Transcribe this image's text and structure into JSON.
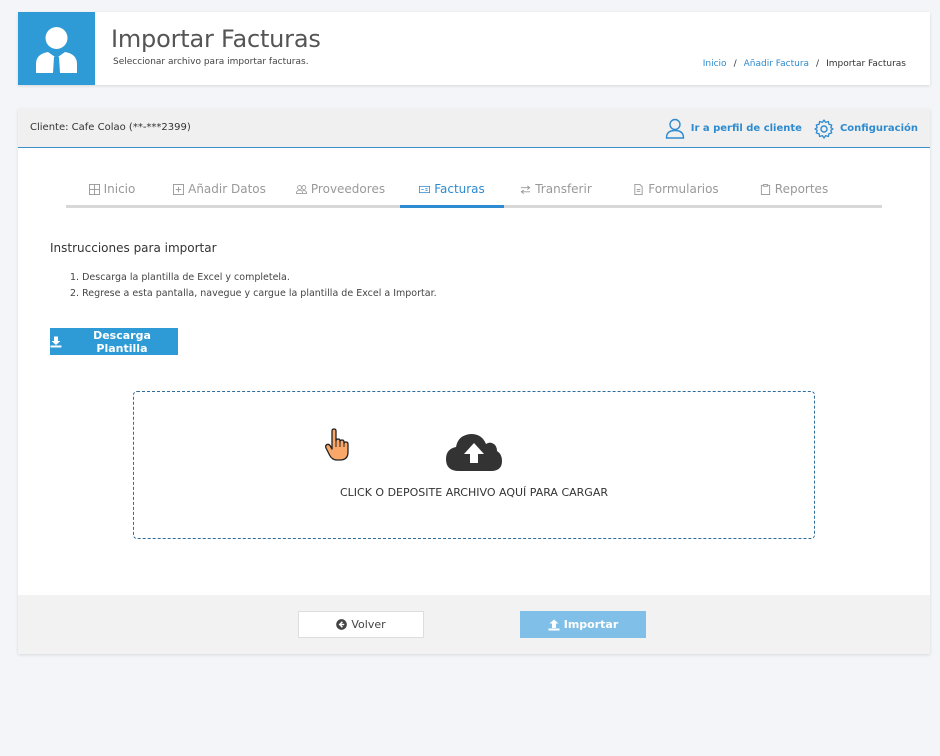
{
  "header": {
    "title": "Importar Facturas",
    "subtitle": "Seleccionar archivo para importar facturas.",
    "breadcrumb": [
      "Inicio",
      "Añadir Factura",
      "Importar Facturas"
    ],
    "icon": "user-tie-icon",
    "accent": "#2e9ad6"
  },
  "client_bar": {
    "client_label": "Cliente: Cafe Colao (**-***2399)",
    "profile_link": "Ir a perfil de cliente",
    "config_link": "Configuración"
  },
  "tabs": [
    {
      "label": "Inicio",
      "icon": "grid-icon",
      "active": false
    },
    {
      "label": "Añadir Datos",
      "icon": "plus-square-icon",
      "active": false
    },
    {
      "label": "Proveedores",
      "icon": "users-icon",
      "active": false
    },
    {
      "label": "Facturas",
      "icon": "invoice-icon",
      "active": true
    },
    {
      "label": "Transferir",
      "icon": "exchange-icon",
      "active": false
    },
    {
      "label": "Formularios",
      "icon": "file-icon",
      "active": false
    },
    {
      "label": "Reportes",
      "icon": "clipboard-icon",
      "active": false
    }
  ],
  "instructions": {
    "title": "Instrucciones para importar",
    "steps": [
      "1. Descarga la plantilla de Excel y completela.",
      "2. Regrese a esta pantalla, navegue y cargue la plantilla de Excel a Importar."
    ]
  },
  "download_button": "Descarga Plantilla",
  "dropzone": {
    "text": "CLICK O DEPOSITE ARCHIVO AQUÍ PARA CARGAR",
    "icon": "cloud-upload-icon"
  },
  "footer": {
    "back_button": "Volver",
    "import_button": "Importar"
  }
}
